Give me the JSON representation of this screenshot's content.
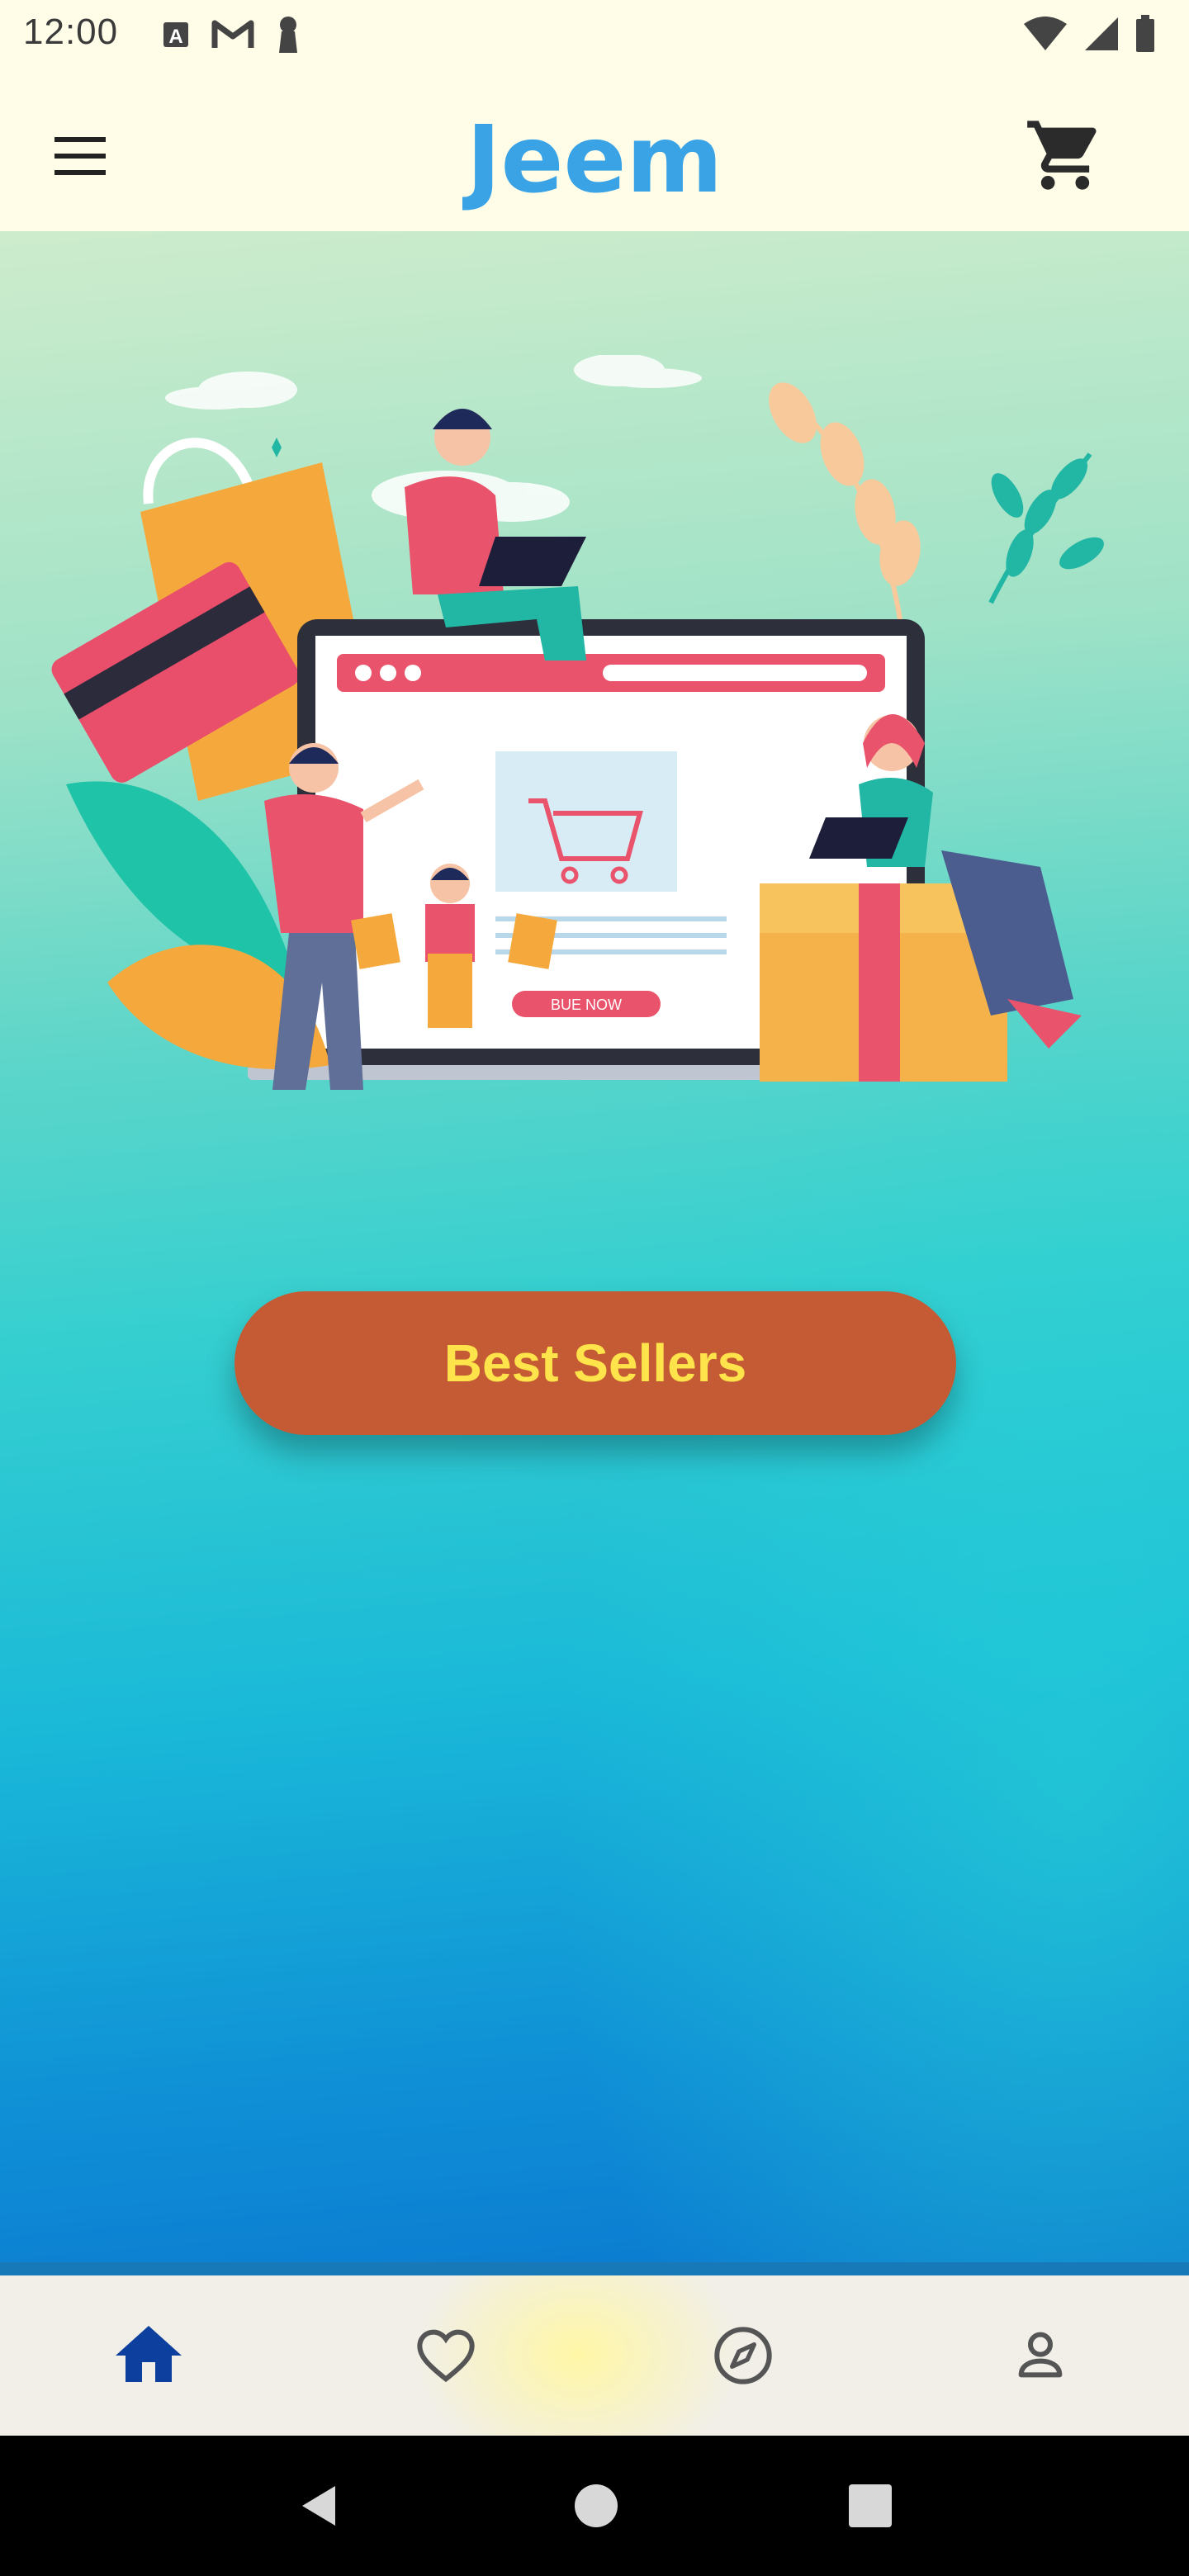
{
  "status_bar": {
    "time": "12:00",
    "icons_left": [
      "a-notification-icon",
      "gmail-icon",
      "keyhole-icon"
    ],
    "icons_right": [
      "wifi-icon",
      "signal-icon",
      "battery-icon"
    ]
  },
  "app_bar": {
    "logo_text": "Jeem",
    "menu_icon": "menu-icon",
    "cart_icon": "cart-icon"
  },
  "hero": {
    "illustration_button_text": "BUE NOW",
    "cta_label": "Best Sellers"
  },
  "bottom_nav": {
    "items": [
      {
        "icon": "home-icon",
        "active": true
      },
      {
        "icon": "heart-icon",
        "active": false
      },
      {
        "icon": "compass-icon",
        "active": false
      },
      {
        "icon": "profile-icon",
        "active": false
      }
    ]
  },
  "system_nav": [
    "back-icon",
    "home-circle-icon",
    "recents-icon"
  ],
  "colors": {
    "app_bar_bg": "#fffde8",
    "logo": "#3aa3e6",
    "cta_bg": "#c55b34",
    "cta_text": "#ffe34a",
    "nav_active": "#0d3f9f",
    "nav_inactive": "#555555"
  }
}
